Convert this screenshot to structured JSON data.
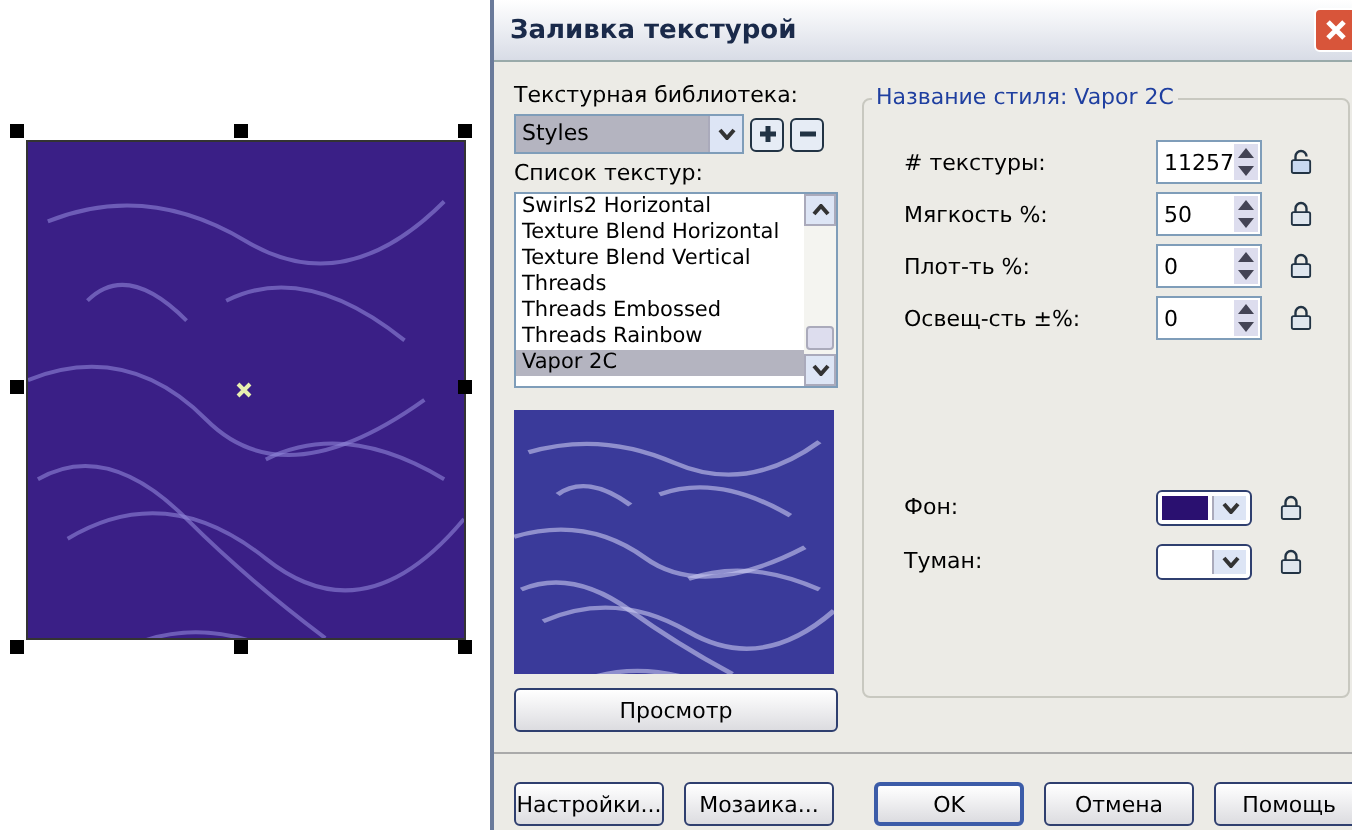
{
  "window": {
    "title": "Заливка текстурой"
  },
  "library": {
    "label": "Текстурная библиотека:",
    "value": "Styles"
  },
  "texture_list": {
    "label": "Список текстур:",
    "items": [
      {
        "label": "Swirls2 Horizontal",
        "selected": false
      },
      {
        "label": "Texture Blend Horizontal",
        "selected": false
      },
      {
        "label": "Texture Blend Vertical",
        "selected": false
      },
      {
        "label": "Threads",
        "selected": false
      },
      {
        "label": "Threads Embossed",
        "selected": false
      },
      {
        "label": "Threads Rainbow",
        "selected": false
      },
      {
        "label": "Vapor 2C",
        "selected": true
      }
    ]
  },
  "preview_button": "Просмотр",
  "style_group": {
    "title": "Название стиля: Vapor 2C",
    "params": [
      {
        "label": "# текстуры:",
        "value": "11257",
        "locked": false
      },
      {
        "label": "Мягкость %:",
        "value": "50",
        "locked": true
      },
      {
        "label": "Плот-ть %:",
        "value": "0",
        "locked": true
      },
      {
        "label": "Освещ-сть ±%:",
        "value": "0",
        "locked": true
      }
    ],
    "colors": [
      {
        "label": "Фон:",
        "color": "#2a1070",
        "locked": true
      },
      {
        "label": "Туман:",
        "color": "#ffffff",
        "locked": true
      }
    ]
  },
  "buttons": [
    "Настройки...",
    "Мозаика...",
    "OK",
    "Отмена",
    "Помощь"
  ]
}
